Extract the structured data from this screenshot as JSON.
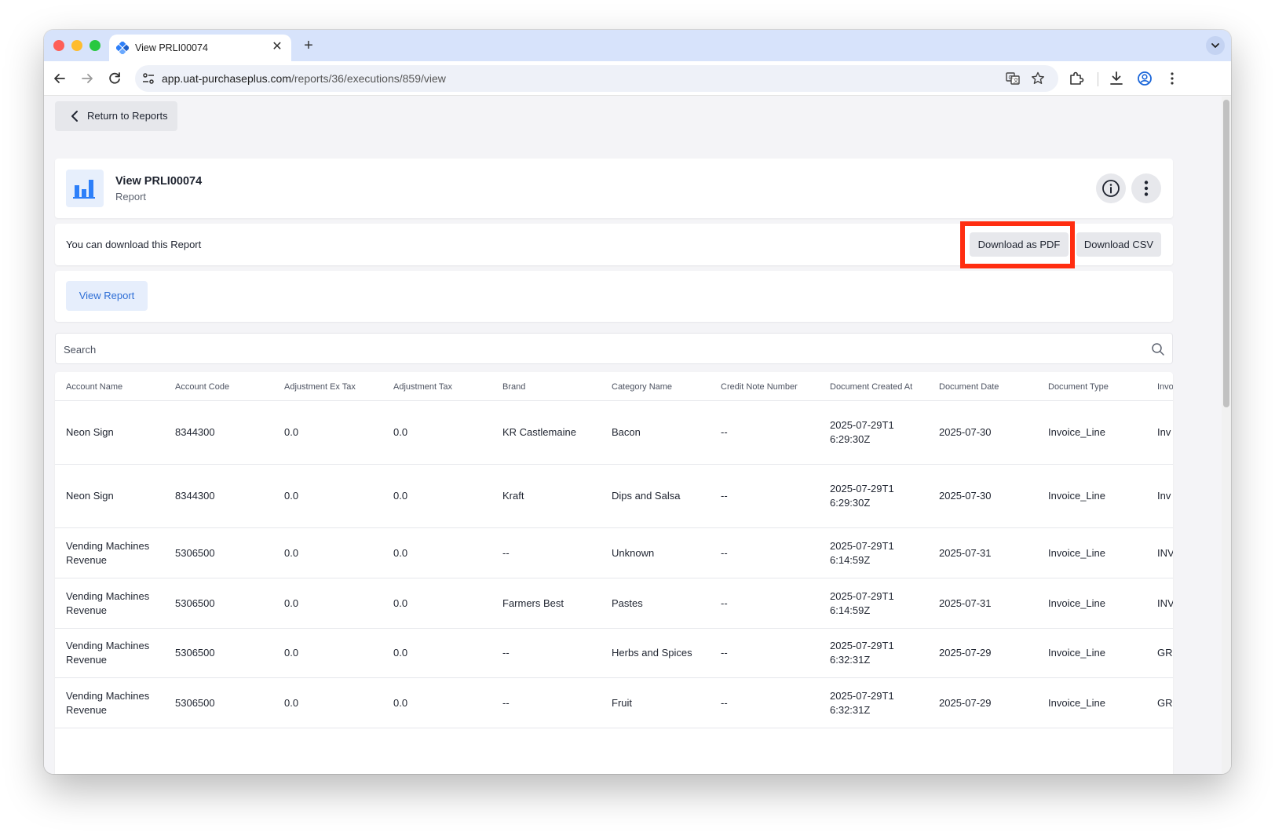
{
  "browser": {
    "tab_title": "View PRLI00074",
    "url_host": "app.uat-purchaseplus.com",
    "url_path": "/reports/36/executions/859/view"
  },
  "page": {
    "return_label": "Return to Reports",
    "header_title": "View PRLI00074",
    "header_subtitle": "Report",
    "download_text": "You can download this Report",
    "download_pdf": "Download as PDF",
    "download_csv": "Download CSV",
    "view_report": "View Report",
    "search_placeholder": "Search"
  },
  "table": {
    "headers": [
      "Account Name",
      "Account Code",
      "Adjustment Ex Tax",
      "Adjustment Tax",
      "Brand",
      "Category Name",
      "Credit Note Number",
      "Document Created At",
      "Document Date",
      "Document Type",
      "Invo"
    ],
    "rows": [
      [
        "Neon Sign",
        "8344300",
        "0.0",
        "0.0",
        "KR Castlemaine",
        "Bacon",
        "--",
        "2025-07-29T16:29:30Z",
        "2025-07-30",
        "Invoice_Line",
        "Inv"
      ],
      [
        "Neon Sign",
        "8344300",
        "0.0",
        "0.0",
        "Kraft",
        "Dips and Salsa",
        "--",
        "2025-07-29T16:29:30Z",
        "2025-07-30",
        "Invoice_Line",
        "Inv"
      ],
      [
        "Vending Machines Revenue",
        "5306500",
        "0.0",
        "0.0",
        "--",
        "Unknown",
        "--",
        "2025-07-29T16:14:59Z",
        "2025-07-31",
        "Invoice_Line",
        "INV"
      ],
      [
        "Vending Machines Revenue",
        "5306500",
        "0.0",
        "0.0",
        "Farmers Best",
        "Pastes",
        "--",
        "2025-07-29T16:14:59Z",
        "2025-07-31",
        "Invoice_Line",
        "INV"
      ],
      [
        "Vending Machines Revenue",
        "5306500",
        "0.0",
        "0.0",
        "--",
        "Herbs and Spices",
        "--",
        "2025-07-29T16:32:31Z",
        "2025-07-29",
        "Invoice_Line",
        "GR"
      ],
      [
        "Vending Machines Revenue",
        "5306500",
        "0.0",
        "0.0",
        "--",
        "Fruit",
        "--",
        "2025-07-29T16:32:31Z",
        "2025-07-29",
        "Invoice_Line",
        "GR"
      ]
    ]
  },
  "colors": {
    "accent_blue": "#2f6fd6",
    "highlight_red": "#ff2d10"
  }
}
